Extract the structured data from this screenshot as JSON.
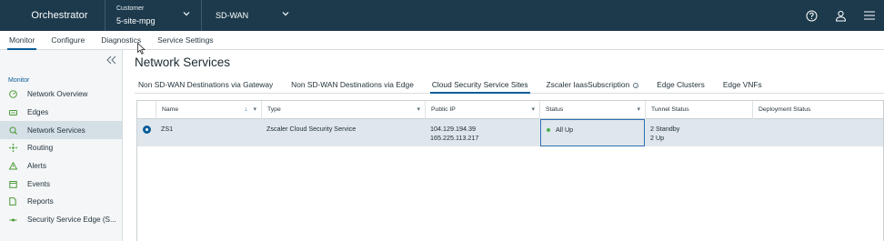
{
  "header": {
    "brand": "Orchestrator",
    "customer_label": "Customer",
    "customer_value": "5-site-mpg",
    "product": "SD-WAN",
    "icons": [
      "help-icon",
      "user-icon",
      "menu-icon"
    ]
  },
  "subnav": {
    "tabs": [
      {
        "label": "Monitor",
        "active": true
      },
      {
        "label": "Configure"
      },
      {
        "label": "Diagnostics"
      },
      {
        "label": "Service Settings"
      }
    ]
  },
  "sidebar": {
    "section": "Monitor",
    "items": [
      {
        "label": "Network Overview",
        "icon": "speedometer-icon"
      },
      {
        "label": "Edges",
        "icon": "edge-device-icon"
      },
      {
        "label": "Network Services",
        "icon": "network-services-icon",
        "active": true
      },
      {
        "label": "Routing",
        "icon": "routing-icon"
      },
      {
        "label": "Alerts",
        "icon": "alert-icon"
      },
      {
        "label": "Events",
        "icon": "events-icon"
      },
      {
        "label": "Reports",
        "icon": "report-icon"
      },
      {
        "label": "Security Service Edge (S...",
        "icon": "sse-icon"
      }
    ]
  },
  "main": {
    "title": "Network Services",
    "tabs": [
      {
        "label": "Non SD-WAN Destinations via Gateway"
      },
      {
        "label": "Non SD-WAN Destinations via Edge"
      },
      {
        "label": "Cloud Security Service Sites",
        "active": true
      },
      {
        "label": "Zscaler IaasSubscription"
      },
      {
        "label": "Edge Clusters"
      },
      {
        "label": "Edge VNFs"
      }
    ],
    "table": {
      "columns": [
        "Name",
        "Type",
        "Public IP",
        "Status",
        "Tunnel Status",
        "Deployment Status"
      ],
      "rows": [
        {
          "name": "ZS1",
          "type": "Zscaler Cloud Security Service",
          "public_ip_1": "104.129.194.39",
          "public_ip_2": "165.225.113.217",
          "status": "All Up",
          "tunnel_status_1": "2 Standby",
          "tunnel_status_2": "2 Up",
          "deployment_status": ""
        }
      ]
    }
  },
  "colors": {
    "header_bg": "#1c3a4c",
    "accent": "#0a5d9a",
    "selected_row": "#dfe7ec",
    "status_ok": "#4caf50"
  }
}
